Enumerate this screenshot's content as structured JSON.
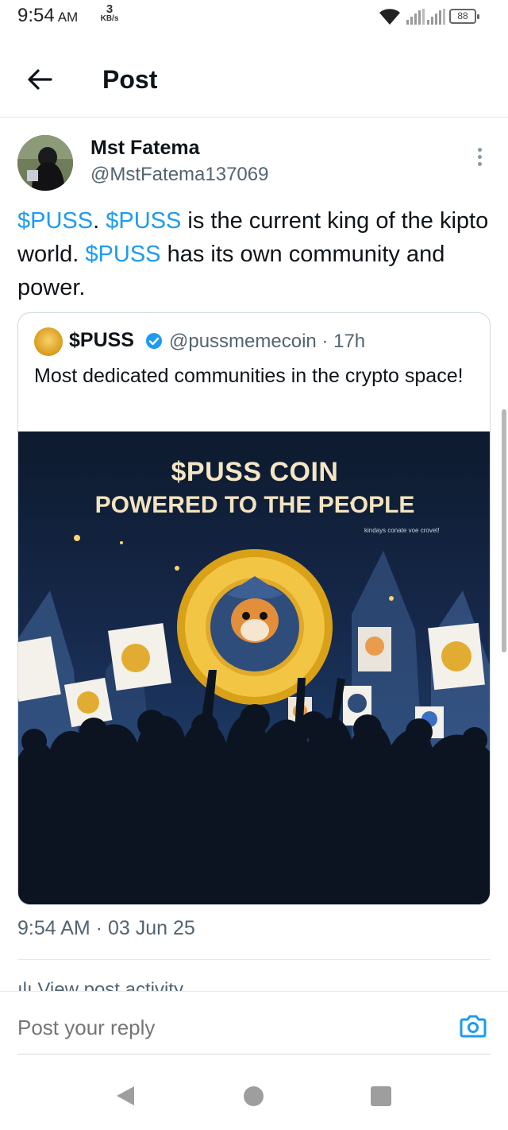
{
  "status_bar": {
    "time": "9:54",
    "ampm": "AM",
    "net_speed": "3",
    "net_unit": "KB/s",
    "battery": "88"
  },
  "header": {
    "title": "Post",
    "back_icon": "arrow-left-icon"
  },
  "post": {
    "author_name": "Mst Fatema",
    "author_handle": "@MstFatema137069",
    "text_segments": [
      "$PUSS",
      ". ",
      "$PUSS",
      " is the current king of the kipto world. ",
      "$PUSS",
      " has its own community and power."
    ],
    "timestamp": "9:54 AM · 03 Jun 25",
    "activity_label": "View post activity"
  },
  "quote": {
    "name": "$PUSS",
    "handle_time": "@pussmemecoin · 17h",
    "text": "Most dedicated communities in the crypto space!",
    "image": {
      "title_line1": "$PUSS COIN",
      "title_line2": "POWERED TO THE PEOPLE",
      "subtitle": "kindays conate voe crovet!"
    }
  },
  "reply": {
    "placeholder": "Post your reply",
    "camera_icon": "camera-icon"
  },
  "colors": {
    "accent": "#1d9bf0",
    "text": "#0f1419",
    "secondary": "#536471"
  }
}
